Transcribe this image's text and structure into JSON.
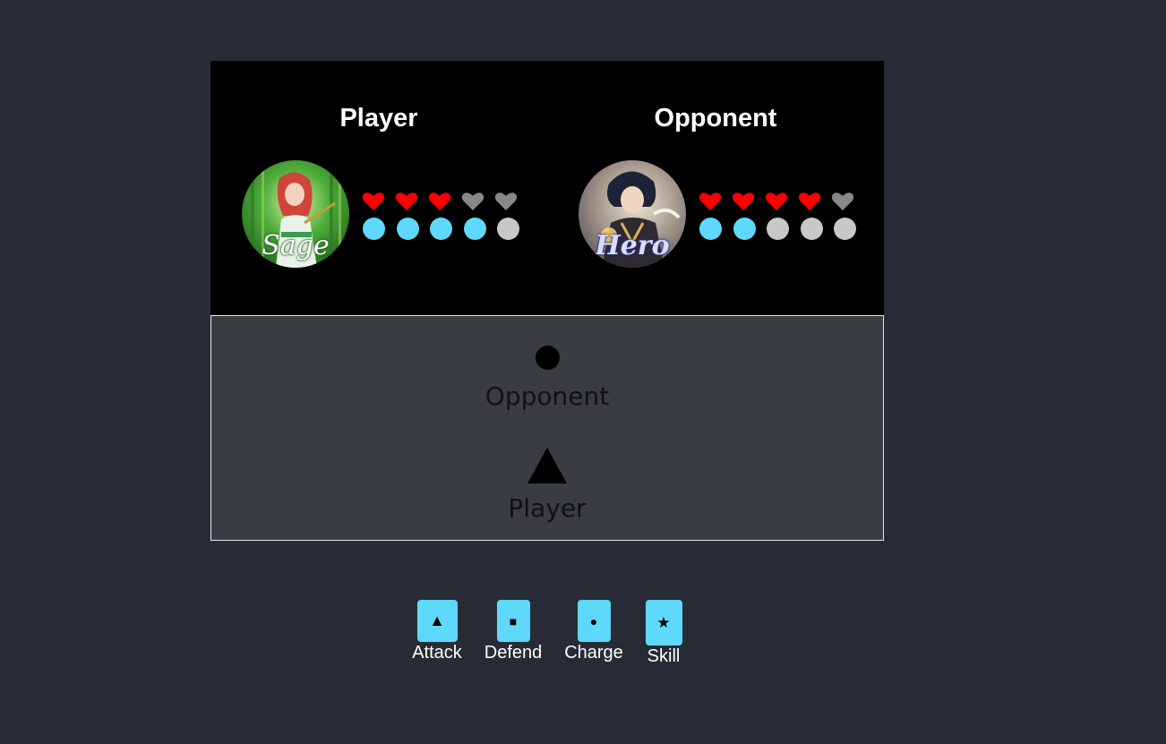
{
  "player": {
    "title": "Player",
    "avatar_label": "Sage",
    "avatar_icon": "sage-portrait",
    "hearts_total": 5,
    "hearts_filled": 3,
    "energy_total": 5,
    "energy_filled": 4
  },
  "opponent": {
    "title": "Opponent",
    "avatar_label": "Hero",
    "avatar_icon": "hero-portrait",
    "hearts_total": 5,
    "hearts_filled": 4,
    "energy_total": 5,
    "energy_filled": 2
  },
  "arena": {
    "opponent_move_icon": "circle-icon",
    "opponent_label": "Opponent",
    "player_move_icon": "triangle-icon",
    "player_label": "Player"
  },
  "controls": [
    {
      "label": "Attack",
      "icon": "triangle-icon",
      "glyph": "▲"
    },
    {
      "label": "Defend",
      "icon": "square-icon",
      "glyph": "■"
    },
    {
      "label": "Charge",
      "icon": "circle-icon",
      "glyph": "●"
    },
    {
      "label": "Skill",
      "icon": "star-icon",
      "glyph": "★"
    }
  ],
  "colors": {
    "background": "#272b35",
    "panel": "#000000",
    "arena": "#393c40",
    "accent": "#5ed8fb",
    "heart_full": "#ff0000",
    "heart_empty": "#888888",
    "energy_empty": "#c8c8c8"
  }
}
